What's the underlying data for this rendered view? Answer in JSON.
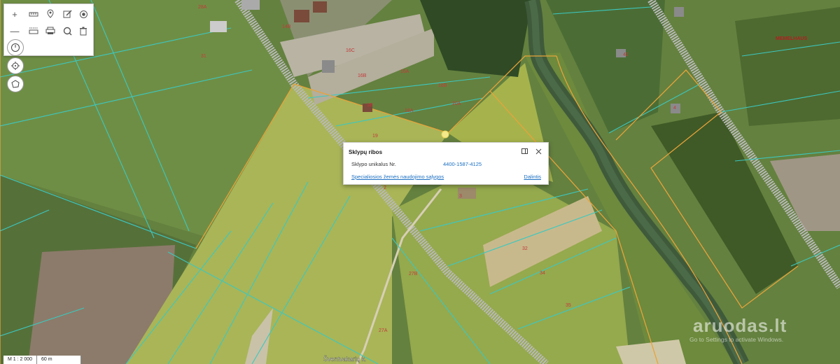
{
  "toolbar": {
    "zoom_in": "+",
    "zoom_out": "—",
    "icons": [
      "measure-line-icon",
      "pin-icon",
      "edit-icon",
      "target-icon",
      "measure-area-icon",
      "print-icon",
      "search-location-icon",
      "trash-icon"
    ]
  },
  "side_buttons": [
    "clock-icon",
    "locate-icon",
    "draw-area-icon"
  ],
  "popup": {
    "title": "Sklypų ribos",
    "row_label": "Sklypo unikalus Nr.",
    "row_value": "4400-1587-4125",
    "link": "Specialiosios žemės naudojimo sąlygos",
    "share": "Dalintis"
  },
  "scale": {
    "ratio": "M 1 : 2 000",
    "length": "60 m"
  },
  "street_label": "Šventvakarių k.",
  "parcel_labels": [
    "28A",
    "31",
    "14B",
    "16C",
    "16B",
    "16A",
    "18B",
    "1B",
    "18A",
    "20A",
    "19",
    "4",
    "2",
    "3",
    "27B",
    "27A",
    "32",
    "34",
    "35",
    "42"
  ],
  "watermark": "aruodas.lt",
  "activate_text": "Go to Settings to activate Windows.",
  "brand_mark": "MEMELHAUS",
  "colors": {
    "parcel_line": "#3cc8c0",
    "boundary_orange": "#e8a33a",
    "road_gray": "#b9b9b9",
    "link_blue": "#1a6fc2"
  }
}
